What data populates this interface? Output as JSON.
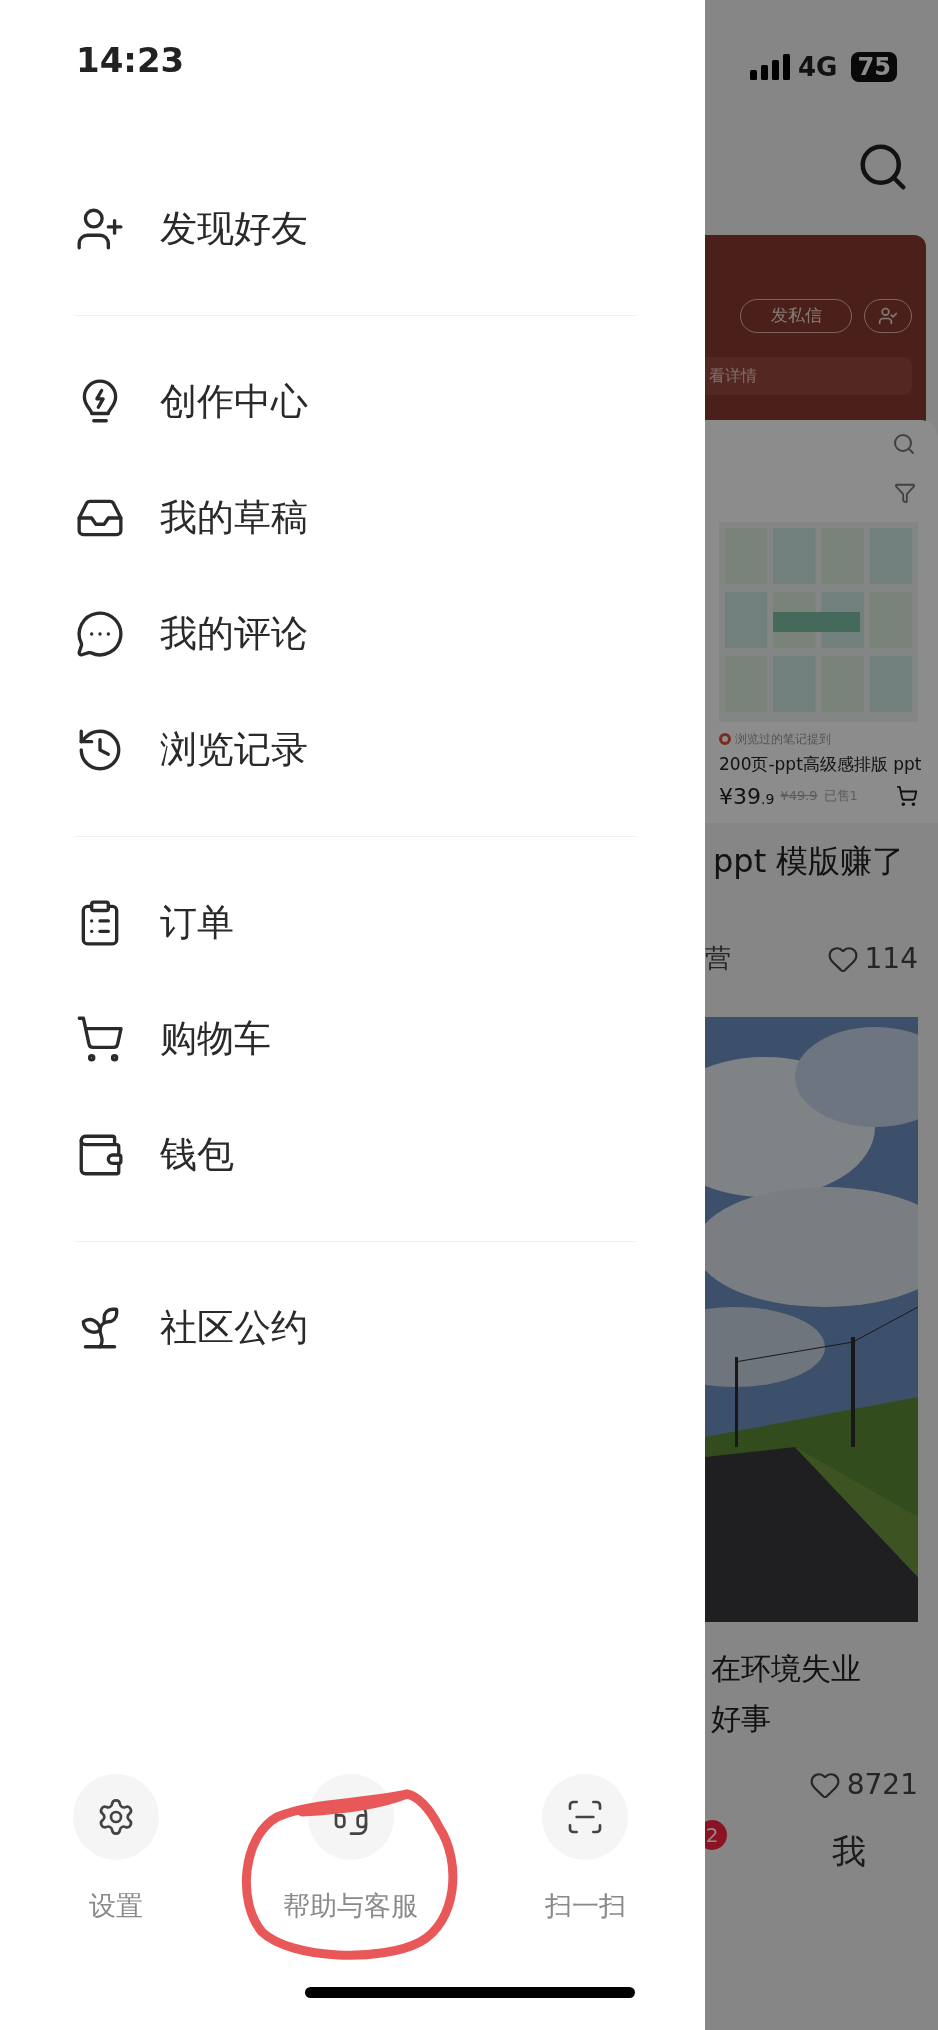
{
  "status_bar": {
    "time": "14:23",
    "network": "4G",
    "battery": "75"
  },
  "drawer": {
    "groups": [
      [
        {
          "kind": "user_plus",
          "label": "发现好友"
        }
      ],
      [
        {
          "kind": "bulb",
          "label": "创作中心"
        },
        {
          "kind": "inbox",
          "label": "我的草稿"
        },
        {
          "kind": "chat",
          "label": "我的评论"
        },
        {
          "kind": "history",
          "label": "浏览记录"
        }
      ],
      [
        {
          "kind": "clipboard",
          "label": "订单"
        },
        {
          "kind": "cart",
          "label": "购物车"
        },
        {
          "kind": "wallet",
          "label": "钱包"
        }
      ],
      [
        {
          "kind": "sprout",
          "label": "社区公约"
        }
      ]
    ],
    "bottom_actions": [
      {
        "kind": "settings",
        "label": "设置"
      },
      {
        "kind": "headset",
        "label": "帮助与客服"
      },
      {
        "kind": "scan",
        "label": "扫一扫"
      }
    ]
  },
  "background_feed": {
    "profile_card": {
      "message_button": "发私信",
      "details_text": "看详情"
    },
    "product_card": {
      "shop": "浏览过的笔记提到",
      "title": "200页-ppt高级感排版 ppt",
      "price": "¥39",
      "price_decimal": ".9",
      "original_price": "¥49.9",
      "sold": "已售1"
    },
    "posts": [
      {
        "title": "ppt 模版赚了",
        "author": "营",
        "likes": "114"
      },
      {
        "title_lines": [
          "在环境失业",
          "好事"
        ],
        "likes": "8721"
      }
    ],
    "tab_badge": "2",
    "tab_label": "我"
  }
}
